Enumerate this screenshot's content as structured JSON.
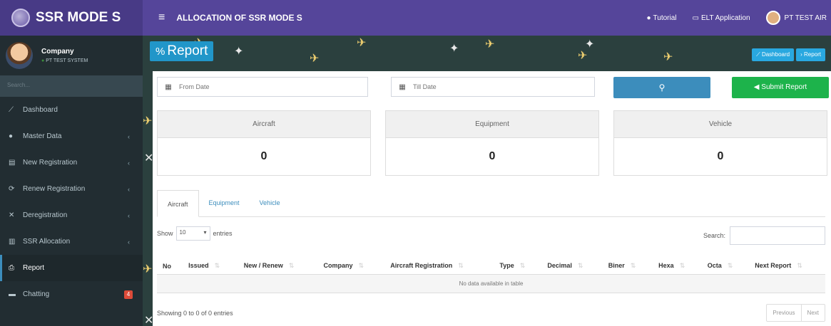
{
  "brand": {
    "title": "SSR MODE S"
  },
  "header": {
    "page_heading": "ALLOCATION OF SSR MODE S",
    "tutorial_label": "Tutorial",
    "elt_label": "ELT Application",
    "user_label": "PT TEST AIR"
  },
  "user_panel": {
    "name": "Company",
    "status": "PT TEST SYSTEM"
  },
  "sidebar": {
    "search_placeholder": "Search...",
    "items": [
      {
        "label": "Dashboard",
        "icon": "chart-line-icon"
      },
      {
        "label": "Master Data",
        "icon": "database-icon"
      },
      {
        "label": "New Registration",
        "icon": "document-icon"
      },
      {
        "label": "Renew Registration",
        "icon": "refresh-icon"
      },
      {
        "label": "Deregistration",
        "icon": "times-icon"
      },
      {
        "label": "SSR Allocation",
        "icon": "bar-chart-icon"
      },
      {
        "label": "Report",
        "icon": "print-icon"
      },
      {
        "label": "Chatting",
        "icon": "chat-icon"
      }
    ],
    "chat_badge": "4"
  },
  "report": {
    "title": "Report",
    "dashboard_btn": "Dashboard",
    "report_btn": "Report"
  },
  "filters": {
    "from_placeholder": "From Date",
    "till_placeholder": "Till Date",
    "submit_label": "Submit Report"
  },
  "stats": [
    {
      "label": "Aircraft",
      "value": "0"
    },
    {
      "label": "Equipment",
      "value": "0"
    },
    {
      "label": "Vehicle",
      "value": "0"
    }
  ],
  "tabs": [
    "Aircraft",
    "Equipment",
    "Vehicle"
  ],
  "table": {
    "show_label": "Show",
    "entries_value": "10",
    "entries_label": "entries",
    "search_label": "Search:",
    "columns": [
      "No",
      "Issued",
      "New / Renew",
      "Company",
      "Aircraft Registration",
      "Type",
      "Decimal",
      "Biner",
      "Hexa",
      "Octa",
      "Next Report"
    ],
    "empty_text": "No data available in table",
    "info": "Showing 0 to 0 of 0 entries",
    "prev_label": "Previous",
    "next_label": "Next"
  },
  "colors": {
    "brand_purple": "#55459a",
    "sidebar_dark": "#222d32",
    "primary_blue": "#3c8dbc",
    "success_green": "#1db34b",
    "report_blue": "#2196c9"
  }
}
